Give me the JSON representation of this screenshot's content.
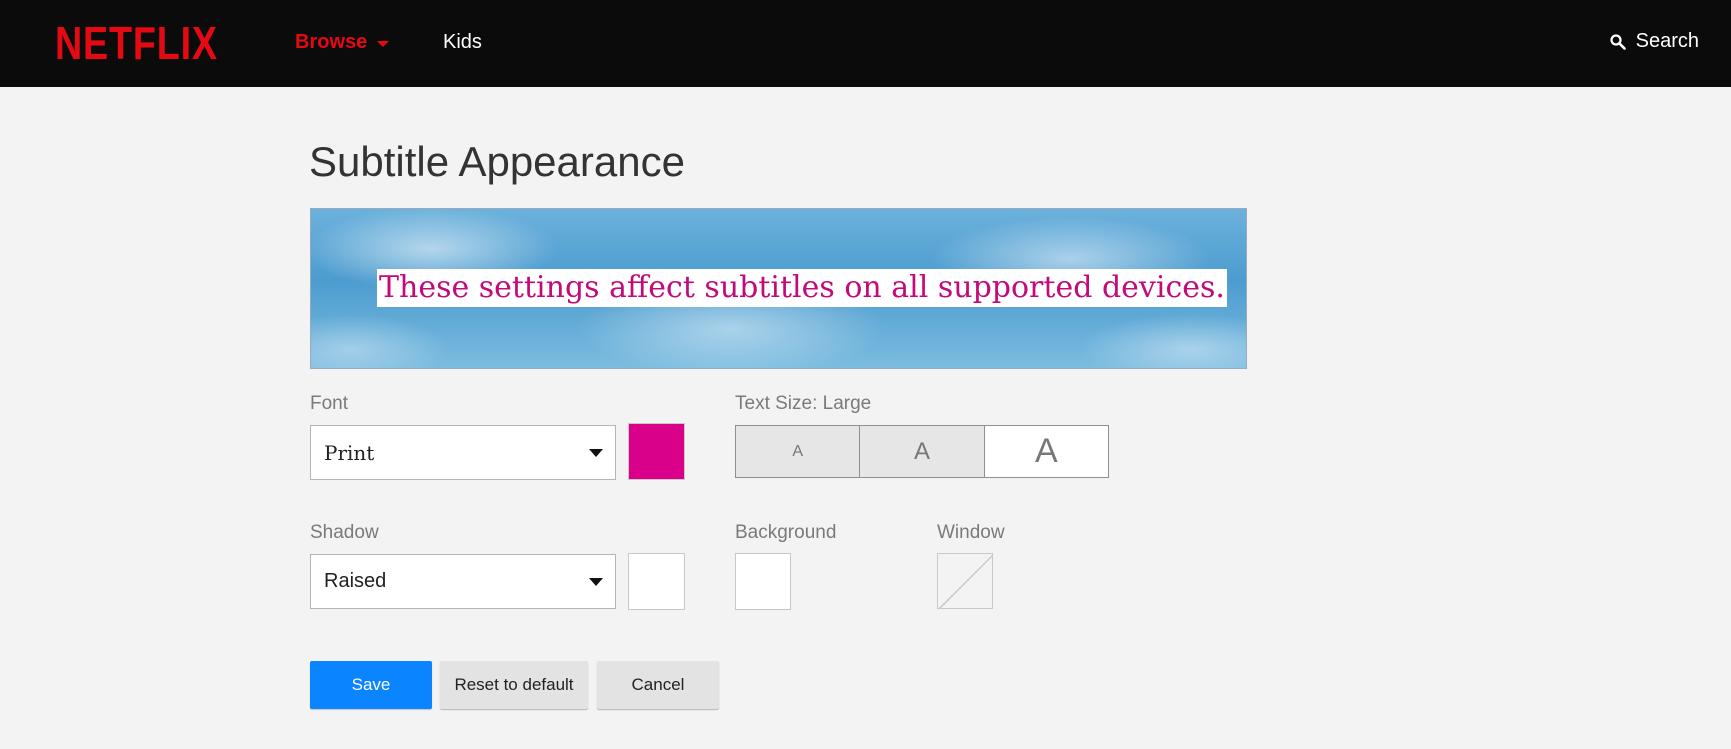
{
  "header": {
    "logo": "NETFLIX",
    "nav": {
      "browse": "Browse",
      "kids": "Kids"
    },
    "search_label": "Search"
  },
  "page": {
    "title": "Subtitle Appearance",
    "preview_text": "These settings affect subtitles on all supported devices."
  },
  "font": {
    "label": "Font",
    "value": "Print",
    "color": "#d9008a"
  },
  "text_size": {
    "label": "Text Size: Large",
    "options": [
      "A",
      "A",
      "A"
    ],
    "selected": "Large"
  },
  "shadow": {
    "label": "Shadow",
    "value": "Raised",
    "color": "#ffffff"
  },
  "background": {
    "label": "Background",
    "color": "#ffffff"
  },
  "window": {
    "label": "Window",
    "color": "none"
  },
  "actions": {
    "save": "Save",
    "reset": "Reset to default",
    "cancel": "Cancel"
  },
  "icons": {
    "search": "search-icon",
    "browse_caret": "caret-down-icon",
    "dropdown_arrow": "dropdown-arrow-icon"
  }
}
